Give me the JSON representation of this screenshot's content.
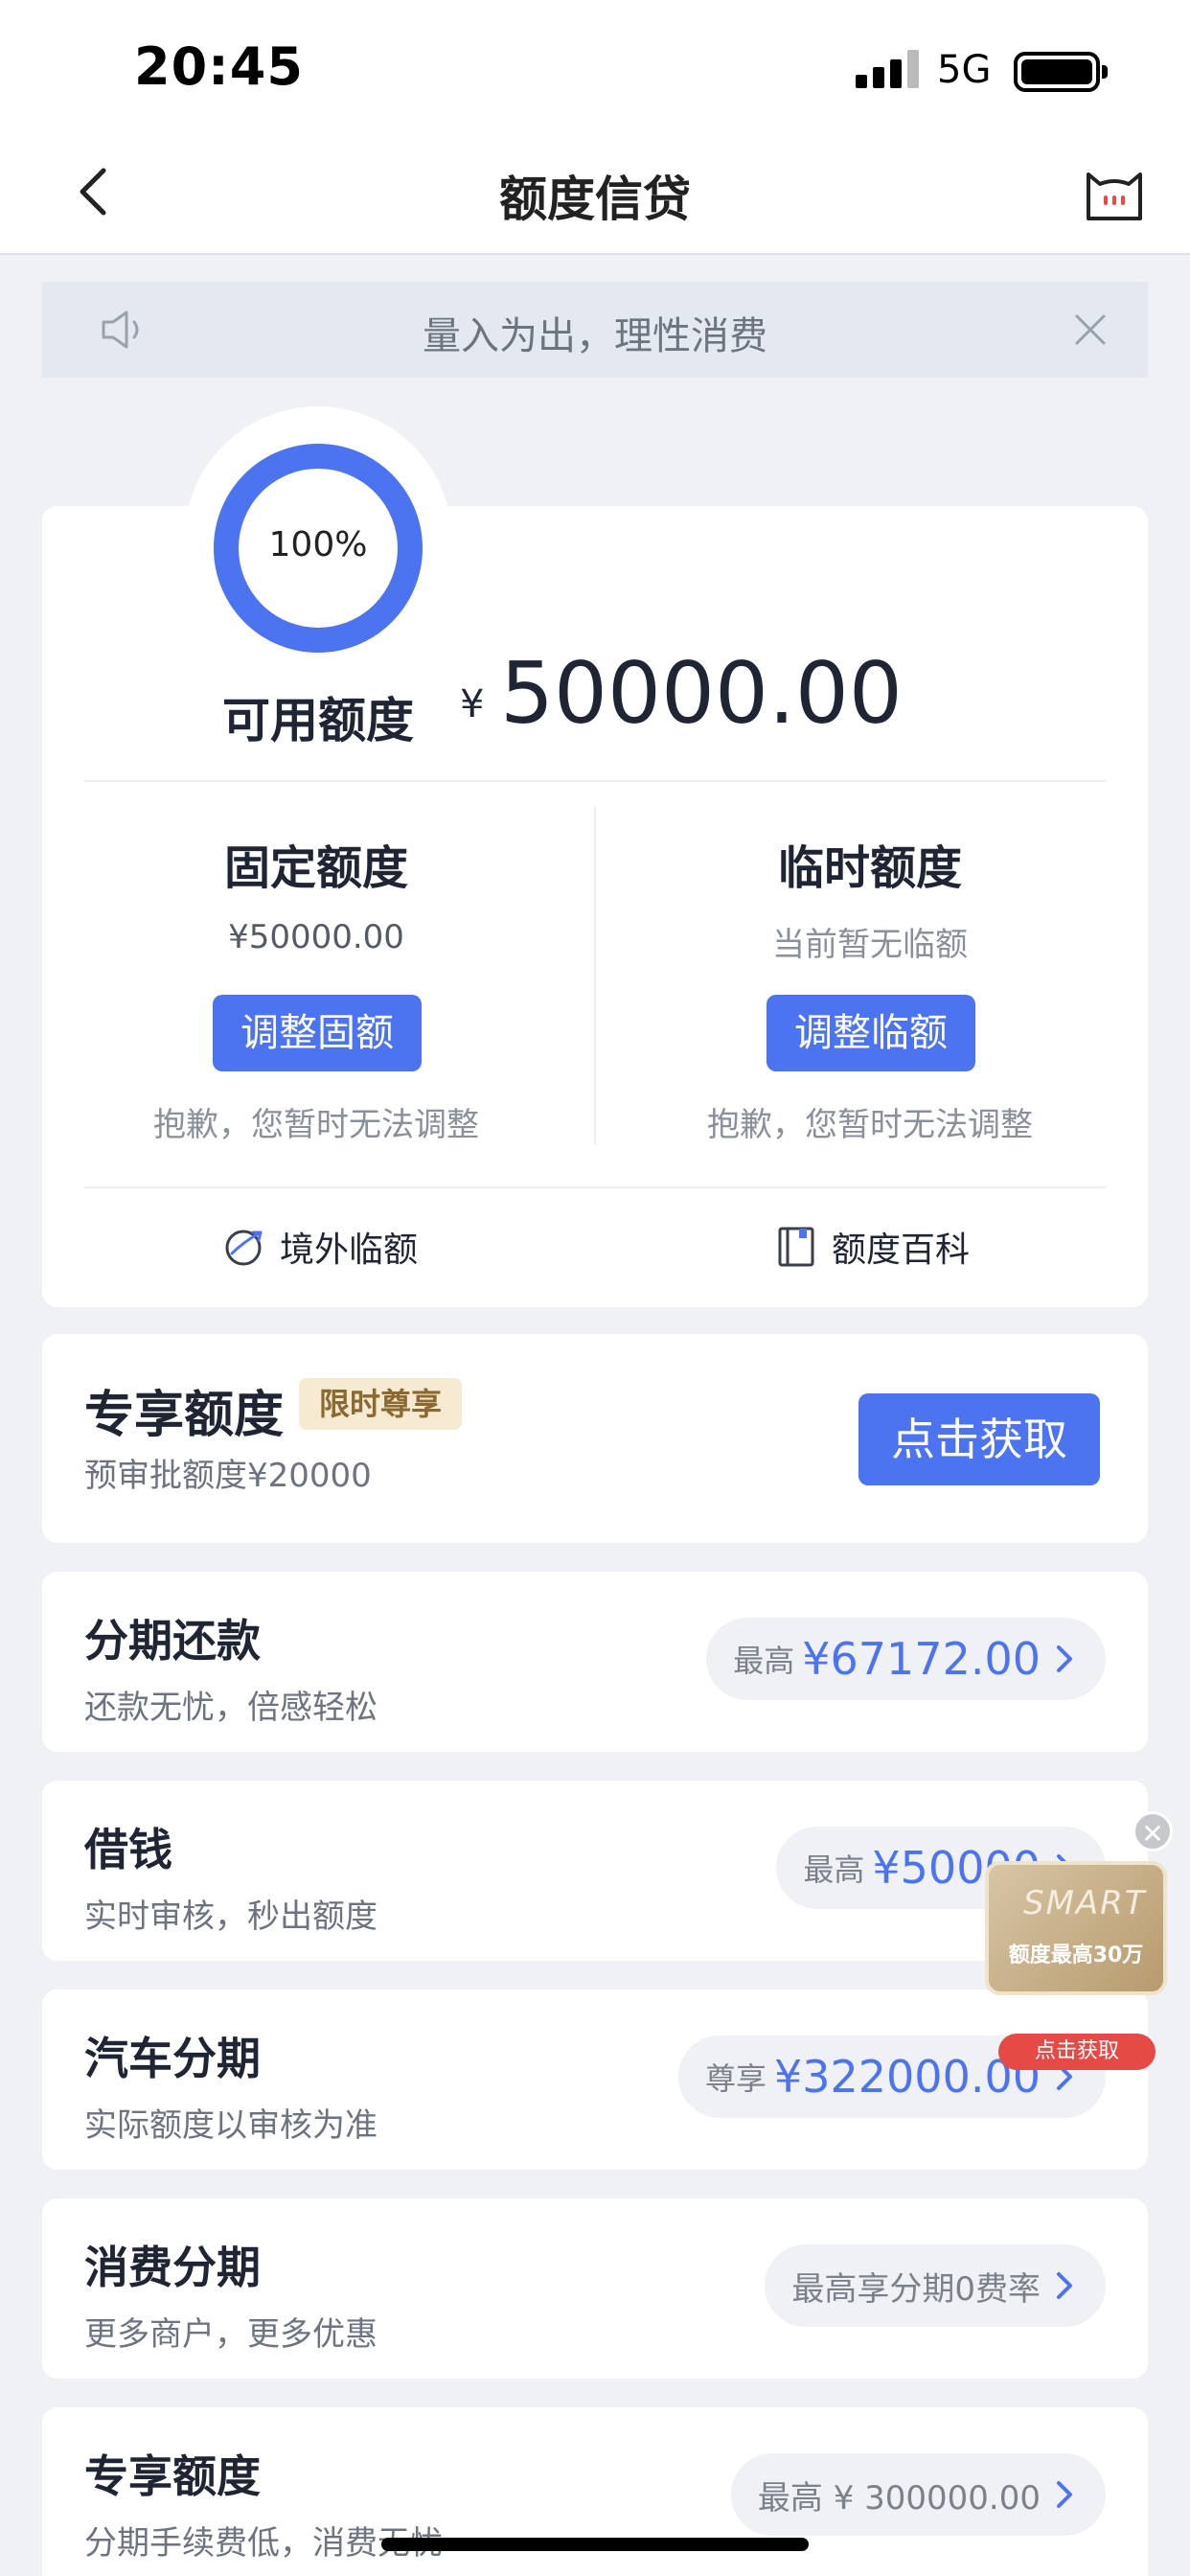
{
  "status_bar": {
    "time": "20:45",
    "network": "5G"
  },
  "nav": {
    "title": "额度信贷"
  },
  "notice": {
    "text": "量入为出，理性消费"
  },
  "quota": {
    "ring_percent_label": "100%",
    "ring_percent": 100,
    "available_label": "可用额度",
    "currency_symbol": "¥",
    "available_amount": "50000.00",
    "fixed": {
      "title": "固定额度",
      "amount": "¥50000.00",
      "button": "调整固额",
      "note": "抱歉，您暂时无法调整"
    },
    "temporary": {
      "title": "临时额度",
      "amount": "当前暂无临额",
      "button": "调整临额",
      "note": "抱歉，您暂时无法调整"
    },
    "links": {
      "overseas": "境外临额",
      "encyclopedia": "额度百科"
    }
  },
  "exclusive": {
    "title": "专享额度",
    "badge": "限时尊享",
    "subtitle": "预审批额度¥20000",
    "button": "点击获取"
  },
  "list": [
    {
      "title": "分期还款",
      "subtitle": "还款无忧，倍感轻松",
      "prefix": "最高",
      "value": "¥67172.00"
    },
    {
      "title": "借钱",
      "subtitle": "实时审核，秒出额度",
      "prefix": "最高",
      "value": "¥50000"
    },
    {
      "title": "汽车分期",
      "subtitle": "实际额度以审核为准",
      "prefix": "尊享",
      "value": "¥322000.00"
    },
    {
      "title": "消费分期",
      "subtitle": "更多商户，更多优惠",
      "plain": "最高享分期0费率"
    },
    {
      "title": "专享额度",
      "subtitle": "分期手续费低，消费无忧",
      "plain": "最高 ¥ 300000.00"
    }
  ],
  "float_ad": {
    "text": "额度最高30万",
    "button": "点击获取",
    "card_word": "SMART"
  },
  "colors": {
    "accent": "#4d74f0",
    "badge_bg": "#f6ead3",
    "badge_text": "#8b6a32",
    "background": "#eff1f5"
  }
}
